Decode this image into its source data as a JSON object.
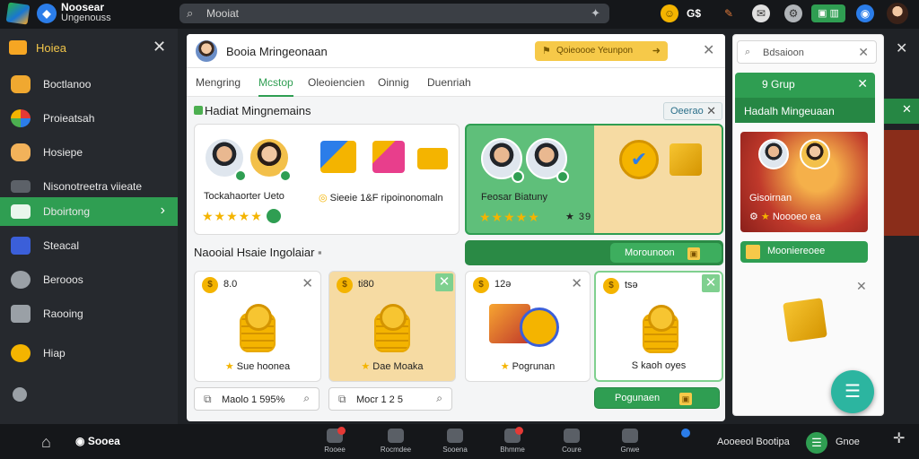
{
  "colors": {
    "accent": "#2f9e52",
    "gold": "#f4b400",
    "dark_bg": "#15171a",
    "sidebar_bg": "#26292e",
    "promo_yellow": "#f6c949"
  },
  "app": {
    "name": "Noosear",
    "subtitle": "Ungenouss"
  },
  "search": {
    "value": "Mooiat",
    "icon": "search-icon",
    "pin_icon": "pin-icon"
  },
  "topbar_icons": [
    "coin-icon",
    "gift-badge-icon",
    "pencil-icon",
    "chat-icon",
    "settings-icon",
    "green-wallet-icon",
    "globe-icon",
    "user-avatar"
  ],
  "topbar": {
    "badge_text": "G$"
  },
  "sidebar": {
    "header": "Hoiea",
    "items": [
      {
        "label": "Boctlanoo",
        "icon": "cup-icon"
      },
      {
        "label": "Proieatsah",
        "icon": "apps-icon"
      },
      {
        "label": "Hosiepe",
        "icon": "jar-icon"
      },
      {
        "label": "Nisonotreetra viieate",
        "icon": "folder-icon"
      },
      {
        "label": "Dboirtong",
        "icon": "monitor-icon",
        "active": true
      },
      {
        "label": "Steacal",
        "icon": "cube-icon"
      },
      {
        "label": "Berooos",
        "icon": "gear-icon"
      },
      {
        "label": "Raooing",
        "icon": "camera-icon"
      },
      {
        "label": "Hiap",
        "icon": "coin-icon"
      },
      {
        "label": "",
        "icon": "location-icon"
      }
    ]
  },
  "main": {
    "title": "Booia Mringeonaan",
    "promo": "Qoieoooe Yeunpon",
    "tabs": [
      "Mengring",
      "Mcstop",
      "Oleoiencien",
      "Oinnig",
      "Duenriah"
    ],
    "active_tab": 1,
    "section1": "Hadiat Mingnemains",
    "chip": "Oeerao",
    "feature_cards": [
      {
        "label": "Tockahaorter Ueto",
        "stars": "★★★★★",
        "note": "Sieeie 1&F ripoinonomaln"
      },
      {
        "label": "Feosar Biatuny",
        "stars": "★★★★★",
        "rating": "★ 39"
      }
    ],
    "big_button": "Morounoon",
    "section2": "Naooial Hsaie Ingolaiar",
    "coin_cards": [
      {
        "amount": "8.0",
        "label": "Sue hoonea"
      },
      {
        "amount": "ti80",
        "label": "Dae Moaka"
      },
      {
        "amount": "12ə",
        "label": "Pogrunan"
      },
      {
        "amount": "tsə",
        "label": "S kaoh oyes"
      }
    ],
    "inputs": [
      {
        "value": "Maolo 1 595%"
      },
      {
        "value": "Mocr 1 2 5"
      }
    ],
    "action_button": "Pogunaen"
  },
  "rpanel": {
    "search": "Bdsaioon",
    "group": "9 Grup",
    "group_sub": "Hadalh Mingeuaan",
    "promo_title": "Gisoirnan",
    "promo_sub": "Noooeo ea",
    "promo_btn": "Mooniereoee"
  },
  "bottombar": {
    "brand": "Sooea",
    "tabs": [
      "Rooee",
      "Rocmdee",
      "Sooena",
      "Bhmme",
      "Coure",
      "Gnwe",
      ""
    ],
    "right_text": "Aooeeol Bootipa",
    "right_text2": "Gnoe"
  }
}
